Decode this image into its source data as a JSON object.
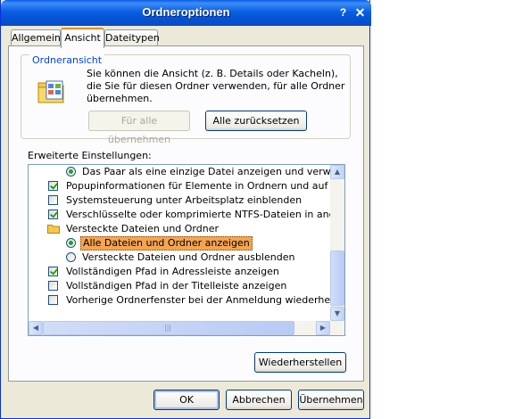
{
  "window": {
    "title": "Ordneroptionen",
    "help_label": "?",
    "close_label": "✕"
  },
  "tabs": [
    {
      "label": "Allgemein",
      "active": false
    },
    {
      "label": "Ansicht",
      "active": true
    },
    {
      "label": "Dateitypen",
      "active": false
    }
  ],
  "folder_view": {
    "legend": "Ordneransicht",
    "description_lines": [
      "Sie können die Ansicht (z. B. Details oder Kacheln),",
      "die Sie für diesen Ordner verwenden, für alle Ordner",
      "übernehmen."
    ],
    "icon": "folder-options-icon",
    "apply_all_label": "Für alle übernehmen",
    "reset_all_label": "Alle zurücksetzen"
  },
  "advanced": {
    "label": "Erweiterte Einstellungen:",
    "items": [
      {
        "type": "radio",
        "checked": true,
        "text": "Das Paar als eine einzige Datei anzeigen und verwalten",
        "level": 1
      },
      {
        "type": "checkbox",
        "checked": true,
        "text": "Popupinformationen für Elemente in Ordnern und auf dem Deskt",
        "level": 0
      },
      {
        "type": "checkbox",
        "checked": false,
        "text": "Systemsteuerung unter Arbeitsplatz einblenden",
        "level": 0
      },
      {
        "type": "checkbox",
        "checked": true,
        "text": "Verschlüsselte oder komprimierte NTFS-Dateien in anderer Farb",
        "level": 0
      },
      {
        "type": "folder",
        "checked": false,
        "text": "Versteckte Dateien und Ordner",
        "level": 0
      },
      {
        "type": "radio",
        "checked": true,
        "text": "Alle Dateien und Ordner anzeigen",
        "level": 1,
        "selected": true
      },
      {
        "type": "radio",
        "checked": false,
        "text": "Versteckte Dateien und Ordner ausblenden",
        "level": 1
      },
      {
        "type": "checkbox",
        "checked": true,
        "text": "Vollständigen Pfad in Adressleiste anzeigen",
        "level": 0
      },
      {
        "type": "checkbox",
        "checked": false,
        "text": "Vollständigen Pfad in der Titelleiste anzeigen",
        "level": 0
      },
      {
        "type": "checkbox",
        "checked": false,
        "text": "Vorherige Ordnerfenster bei der Anmeldung wiederherstellen",
        "level": 0
      }
    ],
    "restore_label": "Wiederherstellen"
  },
  "footer": {
    "ok_label": "OK",
    "cancel_label": "Abbrechen",
    "apply_label": "Übernehmen"
  },
  "colors": {
    "titlebar": "#0a5ce6",
    "accent_tab": "#e68b2c",
    "selection": "#f5a550",
    "check": "#21a121"
  }
}
